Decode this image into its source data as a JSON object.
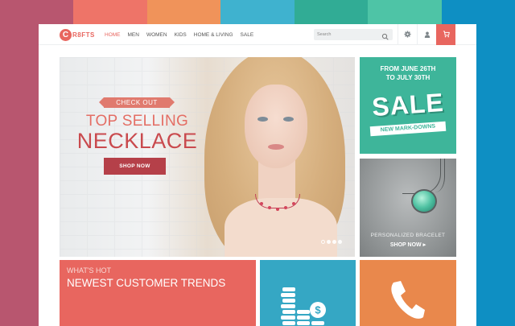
{
  "background": {
    "stripe_colors": [
      "#b8566f",
      "#e8665f",
      "#e9884c",
      "#35a7c4",
      "#2aa08a",
      "#3eb59a",
      "#0e8fc3"
    ],
    "stripe_top_colors": [
      "#b8566f",
      "#ee7468",
      "#f0935a",
      "#3fb2cf",
      "#31ac95",
      "#4ec4a6",
      "#0e8fc3"
    ]
  },
  "nav": {
    "logo_letter": "C",
    "logo_text": "R8FTS",
    "menu": [
      {
        "label": "HOME",
        "active": true
      },
      {
        "label": "MEN"
      },
      {
        "label": "WOMEN"
      },
      {
        "label": "KIDS"
      },
      {
        "label": "HOME & LIVING"
      },
      {
        "label": "SALE"
      }
    ],
    "search_placeholder": "Search",
    "icons": [
      "gear-icon",
      "user-icon",
      "cart-icon"
    ],
    "accent": "#e8665f"
  },
  "hero": {
    "ribbon": "CHECK OUT",
    "subtitle": "TOP SELLING",
    "title": "NECKLACE",
    "button": "SHOP NOW",
    "slides": 4,
    "active_slide": 1
  },
  "sale_tile": {
    "dates_line1": "FROM JUNE 26TH",
    "dates_line2": "TO JULY 30TH",
    "word": "SALE",
    "tag": "NEW MARK-DOWNS",
    "color": "#3eb59a"
  },
  "bracelet_tile": {
    "label": "PERSONALIZED BRACELET",
    "cta": "SHOP NOW ▸"
  },
  "trends_tile": {
    "label": "WHAT'S HOT",
    "title": "NEWEST CUSTOMER TRENDS",
    "color": "#e8665f"
  },
  "money_tile": {
    "icon": "money-icon",
    "color": "#35a7c4"
  },
  "phone_tile": {
    "icon": "phone-icon",
    "color": "#e9884c"
  }
}
